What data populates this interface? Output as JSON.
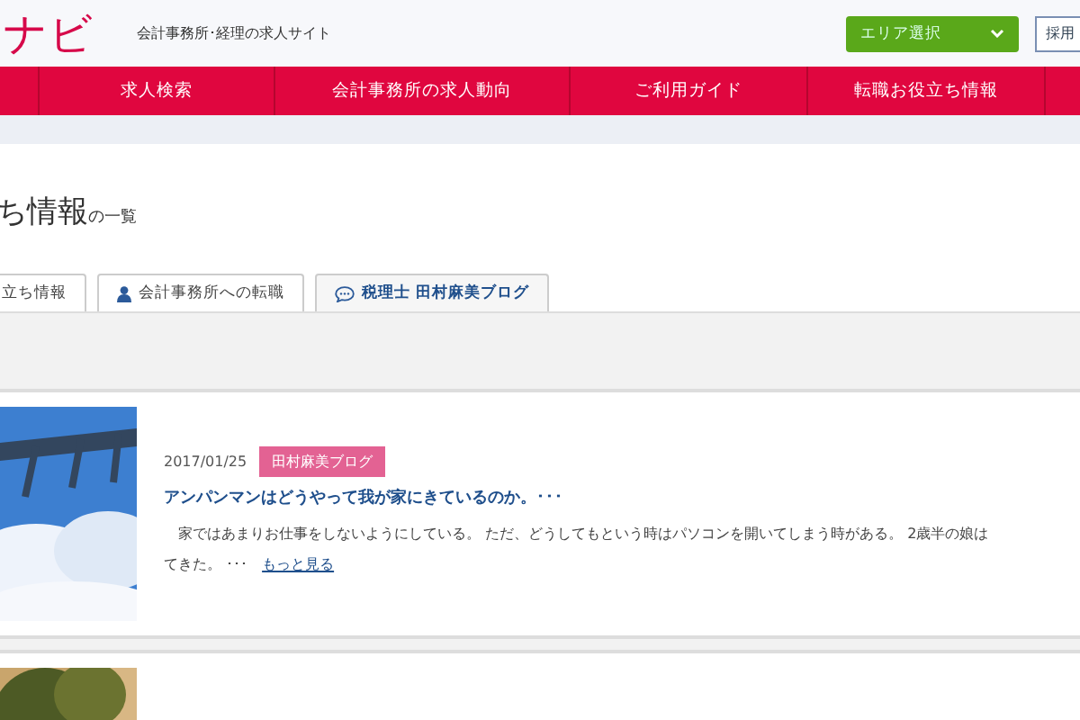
{
  "header": {
    "logo": "ナビ",
    "tagline": "会計事務所･経理の求人サイト",
    "area_select": {
      "label": "エリア選択"
    },
    "button": "採用"
  },
  "nav": [
    "求人検索",
    "会計事務所の求人動向",
    "ご利用ガイド",
    "転職お役立ち情報"
  ],
  "page_title": {
    "main": "ち情報",
    "suffix": "の一覧"
  },
  "tabs": [
    {
      "label": "立ち情報",
      "selected": false
    },
    {
      "label": "会計事務所への転職",
      "selected": false
    },
    {
      "label": "税理士 田村麻美ブログ",
      "selected": true
    }
  ],
  "posts": [
    {
      "date": "2017/01/25",
      "tag": "田村麻美ブログ",
      "title": "アンパンマンはどうやって我が家にきているのか。･･･",
      "body_line_1": "　家ではあまりお仕事をしないようにしている。 ただ、どうしてもという時はパソコンを開いてしまう時がある。 2歳半の娘は",
      "body_line_2": "てきた。 ･･･",
      "more": "もっと見る",
      "picture": {
        "kind": "picture"
      }
    },
    {
      "picture": {
        "kind": "picture"
      }
    }
  ]
}
